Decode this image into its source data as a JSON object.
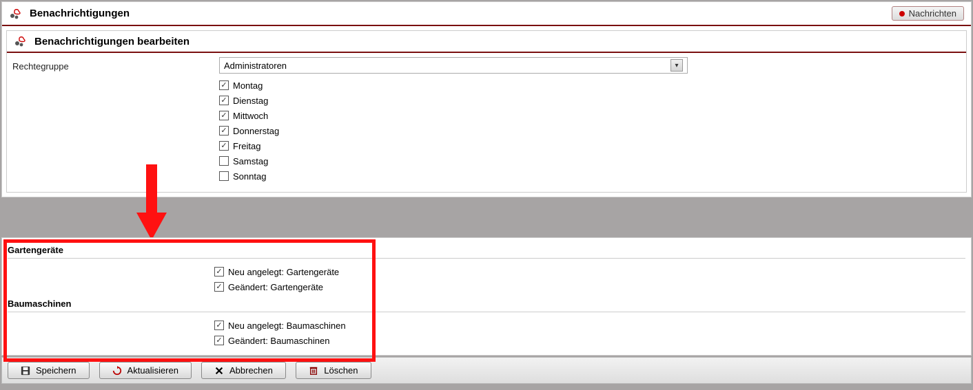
{
  "header": {
    "title": "Benachrichtigungen",
    "messages_button": "Nachrichten"
  },
  "edit": {
    "title": "Benachrichtigungen bearbeiten",
    "group_label": "Rechtegruppe",
    "group_value": "Administratoren",
    "days": [
      {
        "label": "Montag",
        "checked": true
      },
      {
        "label": "Dienstag",
        "checked": true
      },
      {
        "label": "Mittwoch",
        "checked": true
      },
      {
        "label": "Donnerstag",
        "checked": true
      },
      {
        "label": "Freitag",
        "checked": true
      },
      {
        "label": "Samstag",
        "checked": false
      },
      {
        "label": "Sonntag",
        "checked": false
      }
    ]
  },
  "sections": [
    {
      "title": "Gartengeräte",
      "items": [
        {
          "label": "Neu angelegt: Gartengeräte",
          "checked": true
        },
        {
          "label": "Geändert: Gartengeräte",
          "checked": true
        }
      ]
    },
    {
      "title": "Baumaschinen",
      "items": [
        {
          "label": "Neu angelegt: Baumaschinen",
          "checked": true
        },
        {
          "label": "Geändert: Baumaschinen",
          "checked": true
        }
      ]
    }
  ],
  "toolbar": {
    "save": "Speichern",
    "refresh": "Aktualisieren",
    "cancel": "Abbrechen",
    "delete": "Löschen"
  }
}
